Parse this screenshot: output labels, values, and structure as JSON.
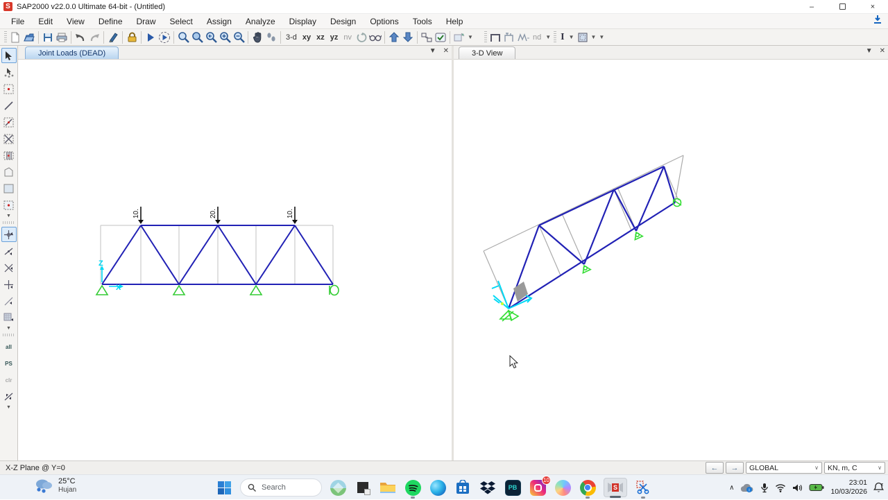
{
  "window": {
    "title": "SAP2000 v22.0.0 Ultimate 64-bit - (Untitled)",
    "app_initial": "S"
  },
  "menu": {
    "items": [
      "File",
      "Edit",
      "View",
      "Define",
      "Draw",
      "Select",
      "Assign",
      "Analyze",
      "Display",
      "Design",
      "Options",
      "Tools",
      "Help"
    ]
  },
  "toolbar": {
    "labels": {
      "three_d": "3-d",
      "xy": "xy",
      "xz": "xz",
      "yz": "yz",
      "nv": "nv",
      "nd": "nd",
      "isection": "I"
    }
  },
  "side_toolbar": {
    "select_all": "all",
    "previous_selection": "PS",
    "clear_selection": "clr"
  },
  "panels": {
    "left": {
      "tab": "Joint Loads (DEAD)"
    },
    "right": {
      "tab": "3-D View"
    }
  },
  "truss": {
    "load_case": "DEAD",
    "loads": [
      "10.",
      "20.",
      "10."
    ],
    "axis2d": {
      "vertical": "Z",
      "horizontal": "X"
    },
    "supports": [
      "pin",
      "pin",
      "pin",
      "roller"
    ],
    "colors": {
      "member": "#2121b5",
      "support": "#33cc33",
      "axis": "#00d9f5",
      "grid": "#c2c2c2",
      "load_arrow": "#111111"
    }
  },
  "statusbar": {
    "message": "X-Z Plane @ Y=0",
    "coord_system": "GLOBAL",
    "units": "KN, m, C"
  },
  "taskbar": {
    "weather": {
      "temperature": "25°C",
      "condition": "Hujan"
    },
    "search": "Search",
    "apps": {
      "pb_label": "PB"
    },
    "badges": {
      "instagram": "10"
    },
    "clock": {
      "time": "23:01",
      "date": "10/03/2026"
    }
  },
  "icons": {
    "titlebar": [
      "minimize-icon",
      "restore-icon",
      "close-icon"
    ],
    "toolbar": [
      "new-file-icon",
      "open-file-icon",
      "save-icon",
      "print-icon",
      "undo-icon",
      "redo-icon",
      "pencil-icon",
      "lock-icon",
      "run-icon",
      "run-animation-icon",
      "zoom-rubberband-icon",
      "zoom-full-icon",
      "zoom-previous-icon",
      "zoom-in-icon",
      "zoom-out-icon",
      "pan-icon",
      "perspective-icon",
      "rotate-icon",
      "glasses-icon",
      "move-up-icon",
      "move-down-icon",
      "shrink-icon",
      "checkbox-icon",
      "frame-icon",
      "section-icon"
    ],
    "tray": [
      "chevron-up-icon",
      "onedrive-icon",
      "microphone-icon",
      "wifi-icon",
      "volume-icon",
      "battery-icon",
      "bell-icon"
    ]
  }
}
